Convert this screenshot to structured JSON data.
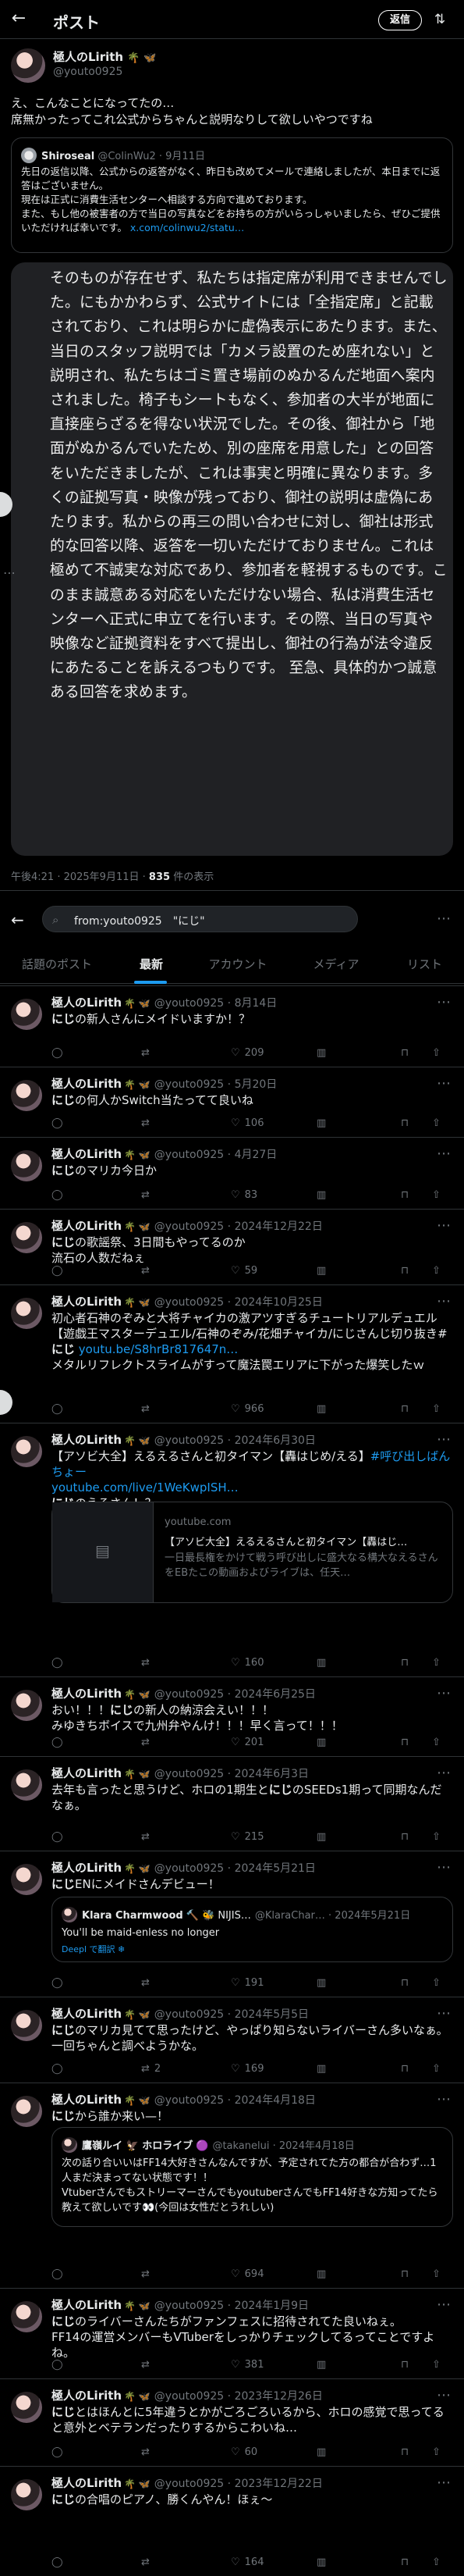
{
  "header": {
    "back_icon": "arrow-left-icon",
    "title": "ポスト",
    "reply_button": "返信",
    "settings_icon": "sliders-icon"
  },
  "main_post": {
    "author_name": "極人のLirith",
    "author_handle": "@youto0925",
    "author_badges": "🌴 🦋",
    "text_line1": "え、こんなことになってたの…",
    "text_line2": "席無かったってこれ公式からちゃんと説明なりして欲しいやつですね",
    "quote": {
      "author_name": "Shiroseal",
      "author_handle": "@ColinWu2",
      "date": "9月11日",
      "line1": "先日の返信以降、公式からの返答がなく、昨日も改めてメールで連絡しましたが、本日までに返答はございません。",
      "line2": "現在は正式に消費生活センターへ相談する方向で進めております。",
      "line3": "また、もし他の被害者の方で当日の写真などをお持ちの方がいらっしゃいましたら、ぜひご提供いただければ幸いです。",
      "link": "x.com/colinwu2/statu…"
    },
    "image_text": "そのものが存在せず、私たちは指定席が利用できませんでした。にもかかわらず、公式サイトには「全指定席」と記載されており、これは明らかに虚偽表示にあたります。また、当日のスタッフ説明では「カメラ設置のため座れない」と説明され、私たちはゴミ置き場前のぬかるんだ地面へ案内されました。椅子もシートもなく、参加者の大半が地面に直接座らざるを得ない状況でした。その後、御社から「地面がぬかるんでいたため、別の座席を用意した」との回答をいただきましたが、これは事実と明確に異なります。多くの証拠写真・映像が残っており、御社の説明は虚偽にあたります。私からの再三の問い合わせに対し、御社は形式的な回答以降、返答を一切いただけておりません。これは極めて不誠実な対応であり、参加者を軽視するものです。このまま誠意ある対応をいただけない場合、私は消費生活センターへ正式に申立てを行います。その際、当日の写真や映像など証拠資料をすべて提出し、御社の行為が法令違反にあたることを訴えるつもりです。 至急、具体的かつ誠意ある回答を求めます。",
    "timestamp": "午後4:21 · 2025年9月11日 ·",
    "views_count": "835",
    "views_label": "件の表示"
  },
  "search": {
    "query": "from:youto0925　\"にじ\"",
    "icon": "search-icon"
  },
  "tabs": [
    "話題のポスト",
    "最新",
    "アカウント",
    "メディア",
    "リスト"
  ],
  "active_tab": "最新",
  "posts": [
    {
      "name": "極人のLirith",
      "badges": "🌴 🦋",
      "handle": "@youto0925",
      "date": "8月14日",
      "hl": "にじ",
      "text": "の新人さんにメイドいますか！？",
      "replies": "",
      "retweets": "",
      "likes": "209",
      "views": ""
    },
    {
      "name": "極人のLirith",
      "badges": "🌴 🦋",
      "handle": "@youto0925",
      "date": "5月20日",
      "hl": "にじ",
      "text": "の何人かSwitch当たってて良いね",
      "replies": "",
      "retweets": "",
      "likes": "106",
      "views": ""
    },
    {
      "name": "極人のLirith",
      "badges": "🌴 🦋",
      "handle": "@youto0925",
      "date": "4月27日",
      "hl": "にじ",
      "text": "のマリカ今日か",
      "replies": "",
      "retweets": "",
      "likes": "83",
      "views": ""
    },
    {
      "name": "極人のLirith",
      "badges": "🌴 🦋",
      "handle": "@youto0925",
      "date": "2024年12月22日",
      "hl": "にじ",
      "text": "の歌謡祭、3日間もやってるのか\n流石の人数だねぇ",
      "replies": "",
      "retweets": "",
      "likes": "59",
      "views": ""
    },
    {
      "name": "極人のLirith",
      "badges": "🌴 🦋",
      "handle": "@youto0925",
      "date": "2024年10月25日",
      "text_pre": "初心者石神のぞみと大将チャイカの激アツすぎるチュートリアルデュエル【遊戯王マスターデュエル/石神のぞみ/花畑チャイカ/にじさんじ切り抜き#",
      "hl": "にじ",
      "text": "",
      "link": "youtu.be/S8hrBr817647n…",
      "text2": "メタルリフレクトスライムがすって魔法罠エリアに下がった爆笑したｗ",
      "replies": "",
      "retweets": "",
      "likes": "966",
      "views": ""
    },
    {
      "name": "極人のLirith",
      "badges": "🌴 🦋",
      "handle": "@youto0925",
      "date": "2024年6月30日",
      "text_pre": "【アソビ大全】えるえるさんと初タイマン【轟はじめ/える】",
      "tag": "#呼び出しばんちょー",
      "link": "youtube.com/live/1WeKwpISH…",
      "hl": "にじ",
      "text": "のえるさん！？",
      "card_domain": "youtube.com",
      "card_title": "【アソビ大全】えるえるさんと初タイマン【轟はじ…",
      "card_desc": "一日最長権をかけて戦う呼び出しに盛大なる構大なえるさんをEBたこの動画およびライブは、任天…",
      "likes": "160"
    },
    {
      "name": "極人のLirith",
      "badges": "🌴 🦋",
      "handle": "@youto0925",
      "date": "2024年6月25日",
      "text_pre": "おい！！！",
      "hl": "にじ",
      "text": "の新人の納涼会えい！！！\nみゆきちボイスで九州弁やんけ！！！早く言って！！！",
      "likes": "201"
    },
    {
      "name": "極人のLirith",
      "badges": "🌴 🦋",
      "handle": "@youto0925",
      "date": "2024年6月3日",
      "text_pre": "去年も言ったと思うけど、ホロの1期生と",
      "hl": "にじ",
      "text": "のSEEDs1期って同期なんだなぁ。",
      "likes": "215"
    },
    {
      "name": "極人のLirith",
      "badges": "🌴 🦋",
      "handle": "@youto0925",
      "date": "2024年5月21日",
      "hl": "にじ",
      "text": "ENにメイドさんデビュー！",
      "quote_name": "Klara Charmwood",
      "quote_badges": "🔨 🐝 NIJIS…",
      "quote_handle": "@KlaraChar…",
      "quote_date": "2024年5月21日",
      "quote_text": "You'll be maid-enless no longer",
      "quote_translate": "Deepl で翻訳 ❄",
      "likes": "191"
    },
    {
      "name": "極人のLirith",
      "badges": "🌴 🦋",
      "handle": "@youto0925",
      "date": "2024年5月5日",
      "hl": "にじ",
      "text": "のマリカ見てて思ったけど、やっぱり知らないライバーさん多いなぁ。\n一回ちゃんと調べようかな。",
      "retweets": "2",
      "likes": "169"
    },
    {
      "name": "極人のLirith",
      "badges": "🌴 🦋",
      "handle": "@youto0925",
      "date": "2024年4月18日",
      "hl": "にじ",
      "text": "から誰か来い—！",
      "quote_name": "鷹嶺ルイ 🦅 ホロライブ",
      "quote_badges": "🟣",
      "quote_handle": "@takanelui",
      "quote_date": "2024年4月18日",
      "quote_text": "次の話り合いいはFF14大好きさんなんですが、予定されてた方の都合が合わず…1人まだ決まってない状態です！！\nVtuberさんでもストリーマーさんでもyoutuberさんでもFF14好きな方知ってたら教えて欲しいです👀(今回は女性だとうれしい)",
      "likes": "694"
    },
    {
      "name": "極人のLirith",
      "badges": "🌴 🦋",
      "handle": "@youto0925",
      "date": "2024年1月9日",
      "hl": "にじ",
      "text": "のライバーさんたちがファンフェスに招待されてた良いねぇ。\nFF14の運営メンバーもVTuberをしっかりチェックしてるってことですよね。",
      "likes": "381"
    },
    {
      "name": "極人のLirith",
      "badges": "🌴 🦋",
      "handle": "@youto0925",
      "date": "2023年12月26日",
      "hl": "にじ",
      "text": "とはほんとに5年違うとかがごろごろいるから、ホロの感覚で思ってると意外とベテランだったりするからこわいね…",
      "likes": "60"
    },
    {
      "name": "極人のLirith",
      "badges": "🌴 🦋",
      "handle": "@youto0925",
      "date": "2023年12月22日",
      "hl": "にじ",
      "text": "の合唱のピアノ、勝くんやん！ほぇ〜",
      "likes": "164"
    }
  ],
  "icons": {
    "reply": "reply-icon",
    "retweet": "retweet-icon",
    "like": "heart-icon",
    "views": "chart-icon",
    "bookmark": "bookmark-icon",
    "share": "share-icon",
    "more": "more-icon"
  }
}
